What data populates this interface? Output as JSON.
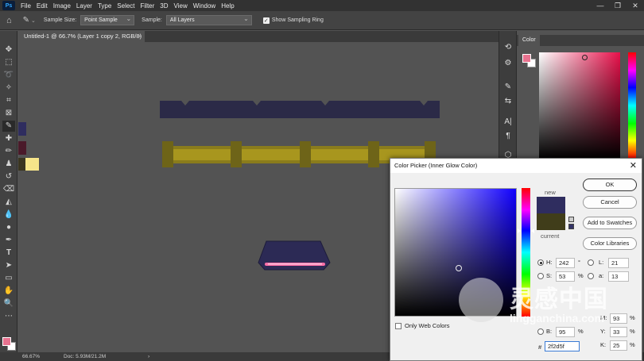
{
  "app": {
    "menu": [
      "File",
      "Edit",
      "Image",
      "Layer",
      "Type",
      "Select",
      "Filter",
      "3D",
      "View",
      "Window",
      "Help"
    ],
    "logo": "Ps"
  },
  "options": {
    "sample_size_label": "Sample Size:",
    "sample_size_value": "Point Sample",
    "sample_label": "Sample:",
    "sample_value": "All Layers",
    "show_ring_label": "Show Sampling Ring"
  },
  "document": {
    "tab_title": "Untitled-1 @ 66.7% (Layer 1 copy 2, RGB/8) *"
  },
  "status": {
    "zoom": "66.67%",
    "doc": "Doc: 5.93M/21.2M"
  },
  "panel": {
    "color_tab": "Color"
  },
  "dialog": {
    "title": "Color Picker (Inner Glow Color)",
    "new_label": "new",
    "current_label": "current",
    "ok": "OK",
    "cancel": "Cancel",
    "add_to_swatches": "Add to Swatches",
    "color_libraries": "Color Libraries",
    "only_web_colors": "Only Web Colors",
    "fields": {
      "H": "242",
      "H_unit": "°",
      "S": "53",
      "S_unit": "%",
      "B": "95",
      "B_unit": "%",
      "L": "21",
      "a": "13",
      "M": "93",
      "M_unit": "%",
      "Y": "33",
      "Y_unit": "%",
      "K": "25",
      "K_unit": "%",
      "hex": "2f2d5f"
    },
    "colors": {
      "new": "#2f2d5f",
      "current": "#403d1a",
      "hue": "#1100ff"
    }
  },
  "watermark": {
    "text": "灵感中国",
    "url": "lingganchina.com"
  },
  "colors": {
    "foreground": "#e8728f",
    "background": "#ffffff"
  }
}
